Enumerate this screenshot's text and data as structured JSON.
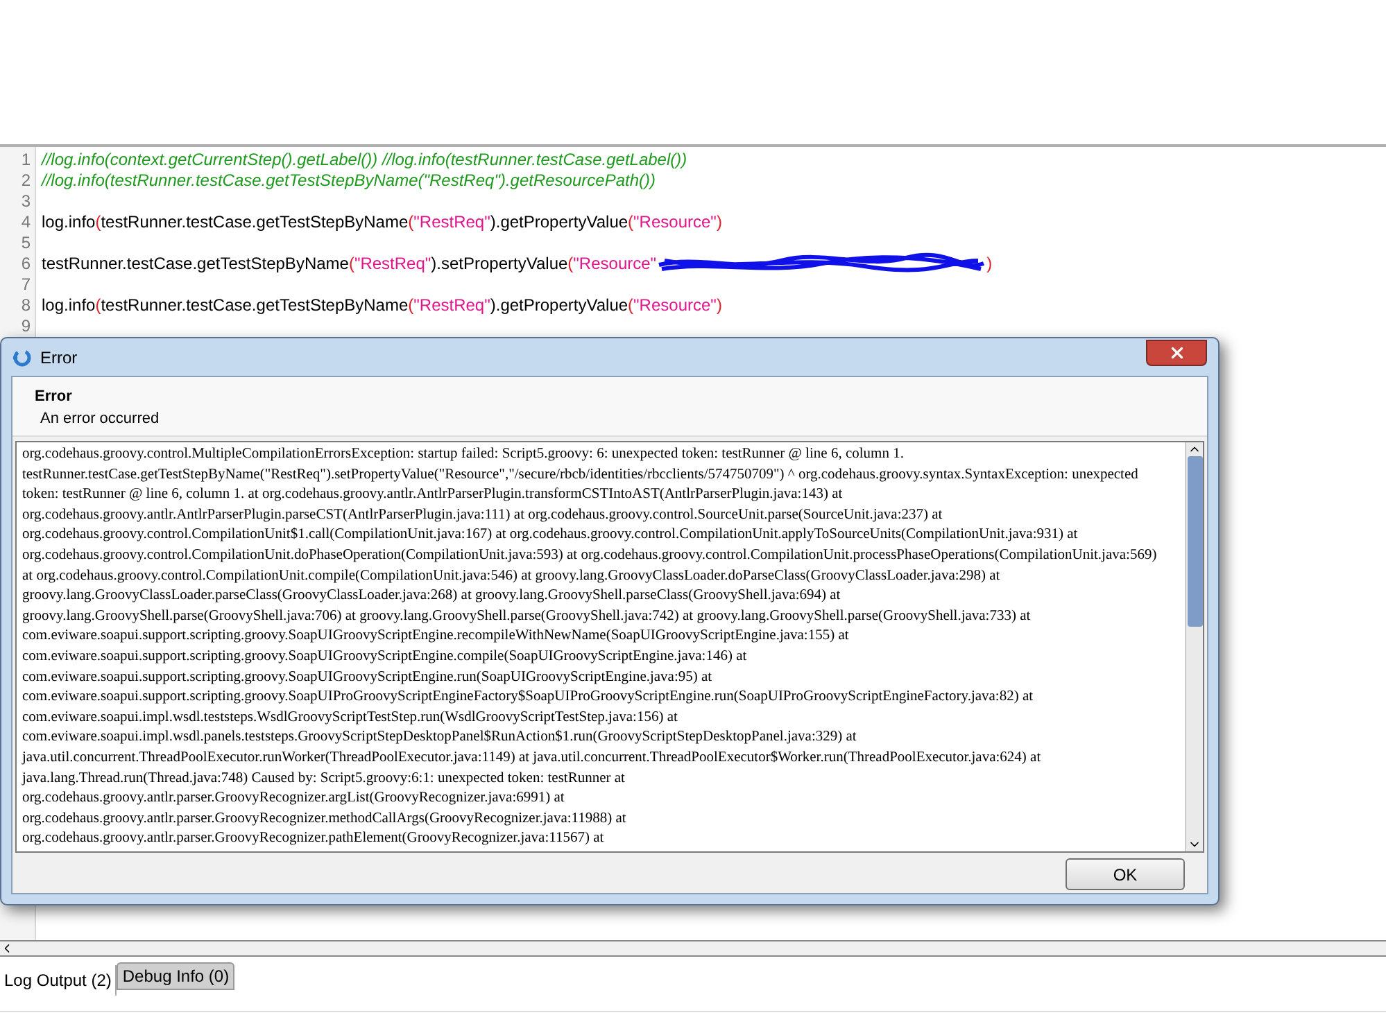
{
  "editor": {
    "lines": [
      {
        "number": "1",
        "tokens": [
          {
            "kind": "comment",
            "text": "//log.info(context.getCurrentStep().getLabel()) //log.info(testRunner.testCase.getLabel())"
          }
        ]
      },
      {
        "number": "2",
        "tokens": [
          {
            "kind": "comment",
            "text": "//log.info(testRunner.testCase.getTestStepByName(\"RestReq\").getResourcePath())"
          }
        ]
      },
      {
        "number": "3"
      },
      {
        "number": "4",
        "tokens": [
          {
            "kind": "plain",
            "text": "log.info"
          },
          {
            "kind": "paren",
            "text": "("
          },
          {
            "kind": "plain",
            "text": "testRunner.testCase.getTestStepByName"
          },
          {
            "kind": "paren",
            "text": "("
          },
          {
            "kind": "string",
            "text": "\"RestReq\""
          },
          {
            "kind": "plain",
            "text": ").getPropertyValue"
          },
          {
            "kind": "paren",
            "text": "("
          },
          {
            "kind": "string",
            "text": "\"Resource\""
          },
          {
            "kind": "paren",
            "text": ")"
          }
        ]
      },
      {
        "number": "5"
      },
      {
        "number": "6",
        "tokens": [
          {
            "kind": "plain",
            "text": "testRunner.testCase.getTestStepByName"
          },
          {
            "kind": "paren",
            "text": "("
          },
          {
            "kind": "string",
            "text": "\"RestReq\""
          },
          {
            "kind": "plain",
            "text": ").setPropertyValue"
          },
          {
            "kind": "paren",
            "text": "("
          },
          {
            "kind": "string",
            "text": "\"Resource\""
          },
          {
            "kind": "redaction"
          },
          {
            "kind": "paren",
            "text": ")"
          }
        ]
      },
      {
        "number": "7"
      },
      {
        "number": "8",
        "tokens": [
          {
            "kind": "plain",
            "text": "log.info"
          },
          {
            "kind": "paren",
            "text": "("
          },
          {
            "kind": "plain",
            "text": "testRunner.testCase.getTestStepByName"
          },
          {
            "kind": "paren",
            "text": "("
          },
          {
            "kind": "string",
            "text": "\"RestReq\""
          },
          {
            "kind": "plain",
            "text": ").getPropertyValue"
          },
          {
            "kind": "paren",
            "text": "("
          },
          {
            "kind": "string",
            "text": "\"Resource\""
          },
          {
            "kind": "paren",
            "text": ")"
          }
        ]
      },
      {
        "number": "9"
      }
    ]
  },
  "dialog": {
    "title": "Error",
    "heading": "Error",
    "subheading": "An error occurred",
    "message_lines": [
      "org.codehaus.groovy.control.MultipleCompilationErrorsException: startup failed: Script5.groovy: 6: unexpected token: testRunner @ line 6, column 1.",
      "testRunner.testCase.getTestStepByName(\"RestReq\").setPropertyValue(\"Resource\",\"/secure/rbcb/identities/rbcclients/574750709\") ^ org.codehaus.groovy.syntax.SyntaxException: unexpected",
      "token: testRunner @ line 6, column 1. at org.codehaus.groovy.antlr.AntlrParserPlugin.transformCSTIntoAST(AntlrParserPlugin.java:143) at",
      "org.codehaus.groovy.antlr.AntlrParserPlugin.parseCST(AntlrParserPlugin.java:111) at org.codehaus.groovy.control.SourceUnit.parse(SourceUnit.java:237) at",
      "org.codehaus.groovy.control.CompilationUnit$1.call(CompilationUnit.java:167) at org.codehaus.groovy.control.CompilationUnit.applyToSourceUnits(CompilationUnit.java:931) at",
      "org.codehaus.groovy.control.CompilationUnit.doPhaseOperation(CompilationUnit.java:593) at org.codehaus.groovy.control.CompilationUnit.processPhaseOperations(CompilationUnit.java:569)",
      "at org.codehaus.groovy.control.CompilationUnit.compile(CompilationUnit.java:546) at groovy.lang.GroovyClassLoader.doParseClass(GroovyClassLoader.java:298) at",
      "groovy.lang.GroovyClassLoader.parseClass(GroovyClassLoader.java:268) at groovy.lang.GroovyShell.parseClass(GroovyShell.java:694) at",
      "groovy.lang.GroovyShell.parse(GroovyShell.java:706) at groovy.lang.GroovyShell.parse(GroovyShell.java:742) at groovy.lang.GroovyShell.parse(GroovyShell.java:733) at",
      "com.eviware.soapui.support.scripting.groovy.SoapUIGroovyScriptEngine.recompileWithNewName(SoapUIGroovyScriptEngine.java:155) at",
      "com.eviware.soapui.support.scripting.groovy.SoapUIGroovyScriptEngine.compile(SoapUIGroovyScriptEngine.java:146) at",
      "com.eviware.soapui.support.scripting.groovy.SoapUIGroovyScriptEngine.run(SoapUIGroovyScriptEngine.java:95) at",
      "com.eviware.soapui.support.scripting.groovy.SoapUIProGroovyScriptEngineFactory$SoapUIProGroovyScriptEngine.run(SoapUIProGroovyScriptEngineFactory.java:82) at",
      "com.eviware.soapui.impl.wsdl.teststeps.WsdlGroovyScriptTestStep.run(WsdlGroovyScriptTestStep.java:156) at",
      "com.eviware.soapui.impl.wsdl.panels.teststeps.GroovyScriptStepDesktopPanel$RunAction$1.run(GroovyScriptStepDesktopPanel.java:329) at",
      "java.util.concurrent.ThreadPoolExecutor.runWorker(ThreadPoolExecutor.java:1149) at java.util.concurrent.ThreadPoolExecutor$Worker.run(ThreadPoolExecutor.java:624) at",
      "java.lang.Thread.run(Thread.java:748) Caused by: Script5.groovy:6:1: unexpected token: testRunner at",
      "org.codehaus.groovy.antlr.parser.GroovyRecognizer.argList(GroovyRecognizer.java:6991) at",
      "org.codehaus.groovy.antlr.parser.GroovyRecognizer.methodCallArgs(GroovyRecognizer.java:11988) at",
      "org.codehaus.groovy.antlr.parser.GroovyRecognizer.pathElement(GroovyRecognizer.java:11567) at"
    ],
    "buttons": [
      "OK"
    ]
  },
  "bottom_tabs": [
    {
      "label": "Log Output (2)",
      "selected": true
    },
    {
      "label": "Debug Info (0)",
      "selected": false
    }
  ]
}
